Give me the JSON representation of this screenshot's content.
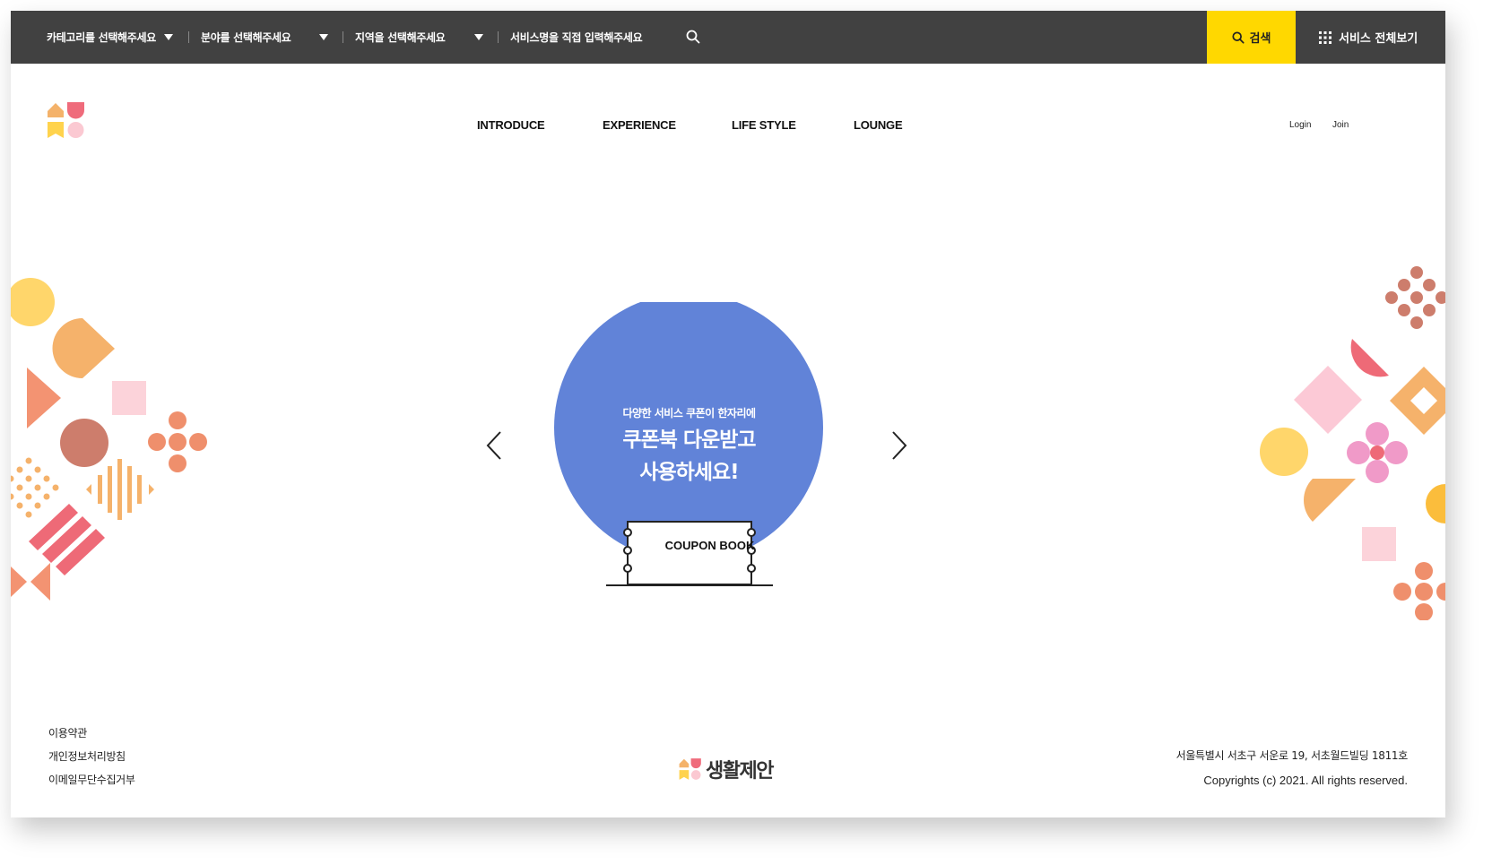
{
  "topbar": {
    "category_select": "카테고리를 선택해주세요",
    "field_select": "분야를 선택해주세요",
    "region_select": "지역을 선택해주세요",
    "service_input_placeholder": "서비스명을 직접 입력해주세요",
    "search_button": "검색",
    "all_services": "서비스 전체보기",
    "search_button_color": "#ffd800",
    "bar_color": "#414141"
  },
  "header": {
    "nav": [
      "INTRODUCE",
      "EXPERIENCE",
      "LIFE STYLE",
      "LOUNGE"
    ],
    "login": "Login",
    "join": "Join"
  },
  "hero": {
    "subtitle": "다양한 서비스 쿠폰이 한자리에",
    "title_line1": "쿠폰북 다운받고",
    "title_line2": "사용하세요!",
    "coupon_label": "COUPON BOOK",
    "circle_color": "#6183d8"
  },
  "footer": {
    "links": [
      "이용약관",
      "개인정보처리방침",
      "이메일무단수집거부"
    ],
    "logo_text": "생활제안",
    "address": "서울특별시 서초구 서운로 19, 서초월드빌딩 1811호",
    "copyright": "Copyrights (c) 2021. All rights reserved."
  }
}
